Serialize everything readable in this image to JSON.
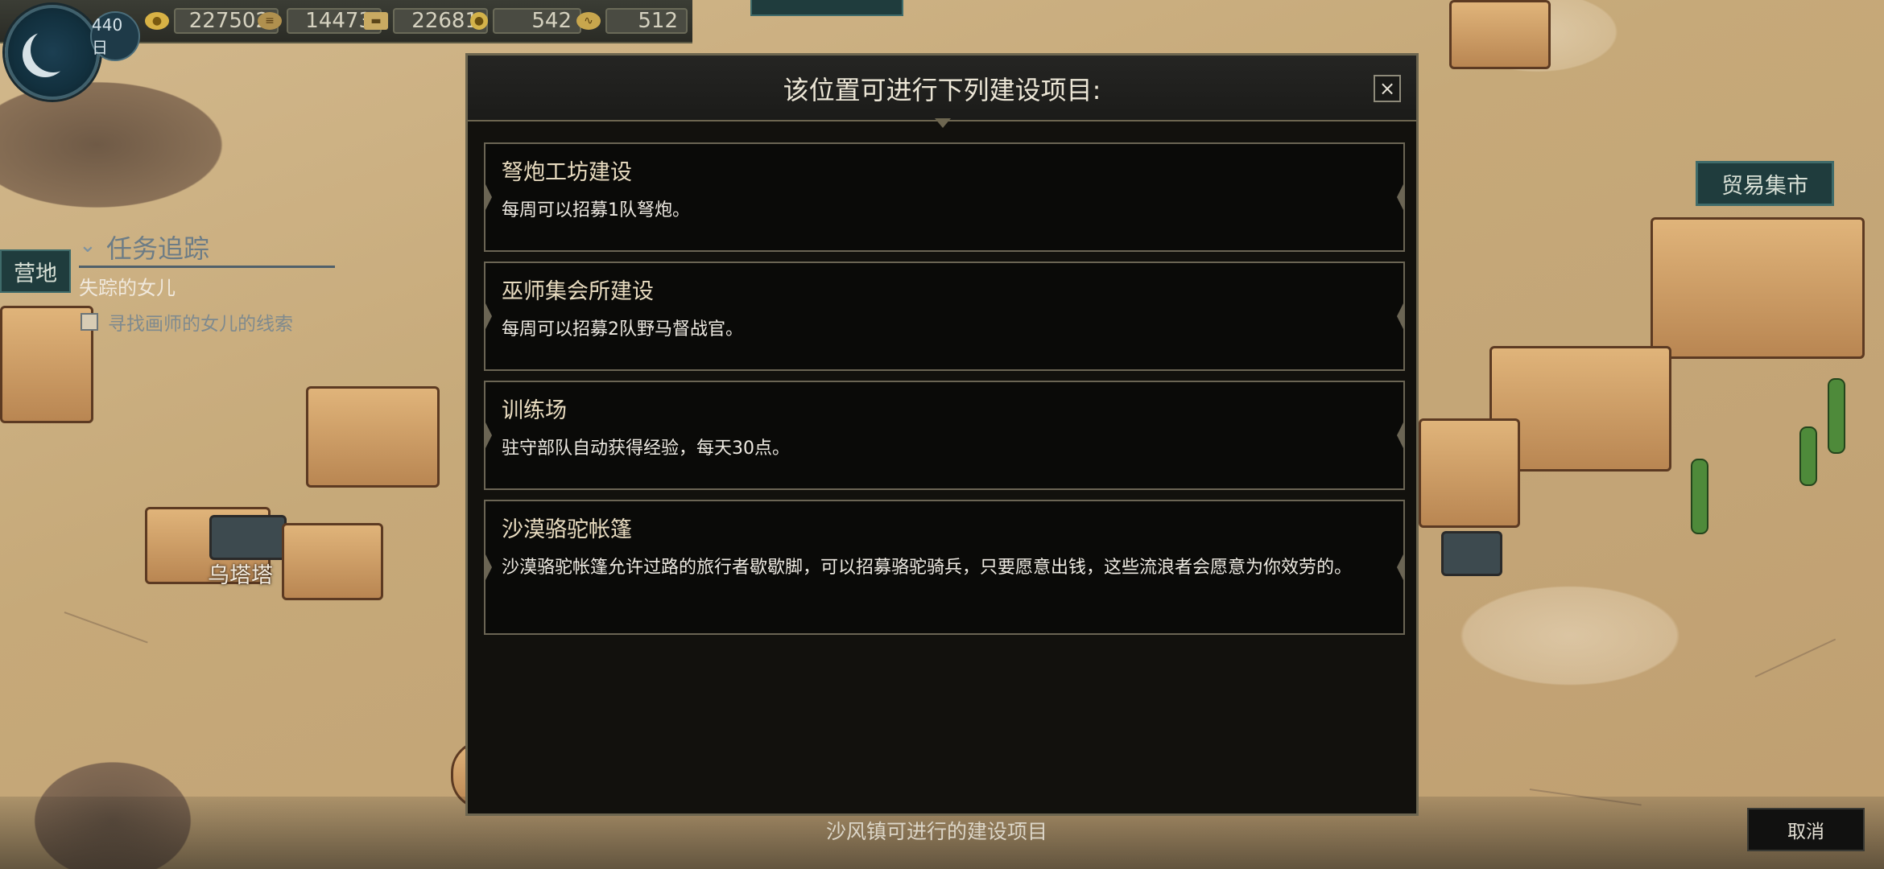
{
  "hud": {
    "day": "440日",
    "resources": [
      {
        "icon": "gold-coins-icon",
        "value": "227502"
      },
      {
        "icon": "wood-logs-icon",
        "value": "14473"
      },
      {
        "icon": "stone-bricks-icon",
        "value": "22681"
      },
      {
        "icon": "crystal-egg-icon",
        "value": "542"
      },
      {
        "icon": "horn-icon",
        "value": "512"
      }
    ]
  },
  "quest": {
    "camp_label": "营地",
    "header": "任务追踪",
    "name": "失踪的女儿",
    "objective": "寻找画师的女儿的线索"
  },
  "map_labels": {
    "town": "乌塔塔",
    "market": "贸易集市"
  },
  "modal": {
    "title": "该位置可进行下列建设项目:",
    "close": "×",
    "items": [
      {
        "title": "弩炮工坊建设",
        "desc": "每周可以招募1队弩炮。"
      },
      {
        "title": "巫师集会所建设",
        "desc": "每周可以招募2队野马督战官。"
      },
      {
        "title": "训练场",
        "desc": "驻守部队自动获得经验，每天30点。"
      },
      {
        "title": "沙漠骆驼帐篷",
        "desc": "沙漠骆驼帐篷允许过路的旅行者歇歇脚，可以招募骆驼骑兵，只要愿意出钱，这些流浪者会愿意为你效劳的。"
      }
    ]
  },
  "bottom": {
    "caption": "沙风镇可进行的建设项目",
    "cancel": "取消"
  },
  "colors": {
    "panel_bg": "#12110d",
    "panel_border": "#6d6650",
    "tag_teal": "#1f3c3d",
    "item_title": "#e9dcc0"
  }
}
